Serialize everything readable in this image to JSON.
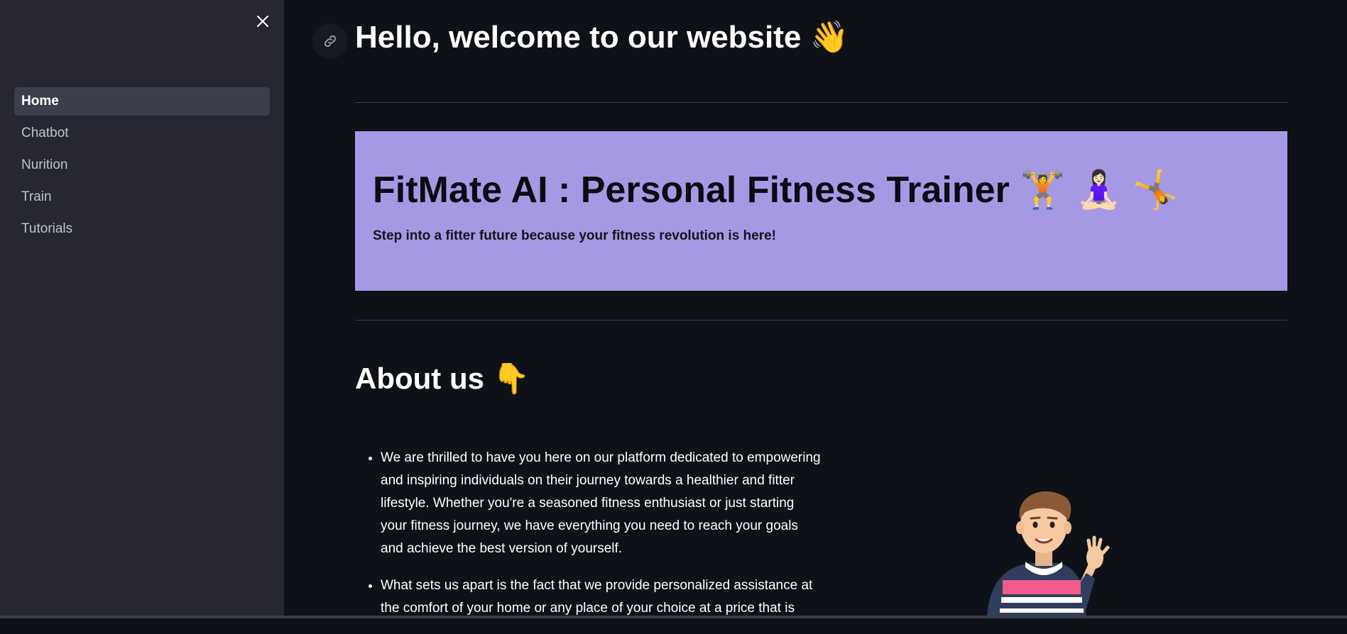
{
  "sidebar": {
    "close_icon": "close-icon",
    "items": [
      {
        "label": "Home",
        "active": true
      },
      {
        "label": "Chatbot",
        "active": false
      },
      {
        "label": "Nurition",
        "active": false
      },
      {
        "label": "Train",
        "active": false
      },
      {
        "label": "Tutorials",
        "active": false
      }
    ]
  },
  "main": {
    "anchor_icon": "link-icon",
    "page_title": "Hello, welcome to our website 👋",
    "hero": {
      "title": "FitMate AI : Personal Fitness Trainer 🏋️ 🧘🏻‍♀️ 🤸",
      "subtitle": "Step into a fitter future because your fitness revolution is here!",
      "background": "#a699e4"
    },
    "about": {
      "heading": "About us 👇",
      "paragraphs": [
        "We are thrilled to have you here on our platform dedicated to empowering and inspiring individuals on their journey towards a healthier and fitter lifestyle. Whether you're a seasoned fitness enthusiast or just starting your fitness journey, we have everything you need to reach your goals and achieve the best version of yourself.",
        "What sets us apart is the fact that we provide personalized assistance at the comfort of your home or any place of your choice at a price that is"
      ]
    },
    "mascot_image": "waving-man-illustration"
  },
  "colors": {
    "background": "#0e1117",
    "sidebar": "#262730",
    "active_item": "#3d3e4b",
    "hero": "#a699e4"
  }
}
